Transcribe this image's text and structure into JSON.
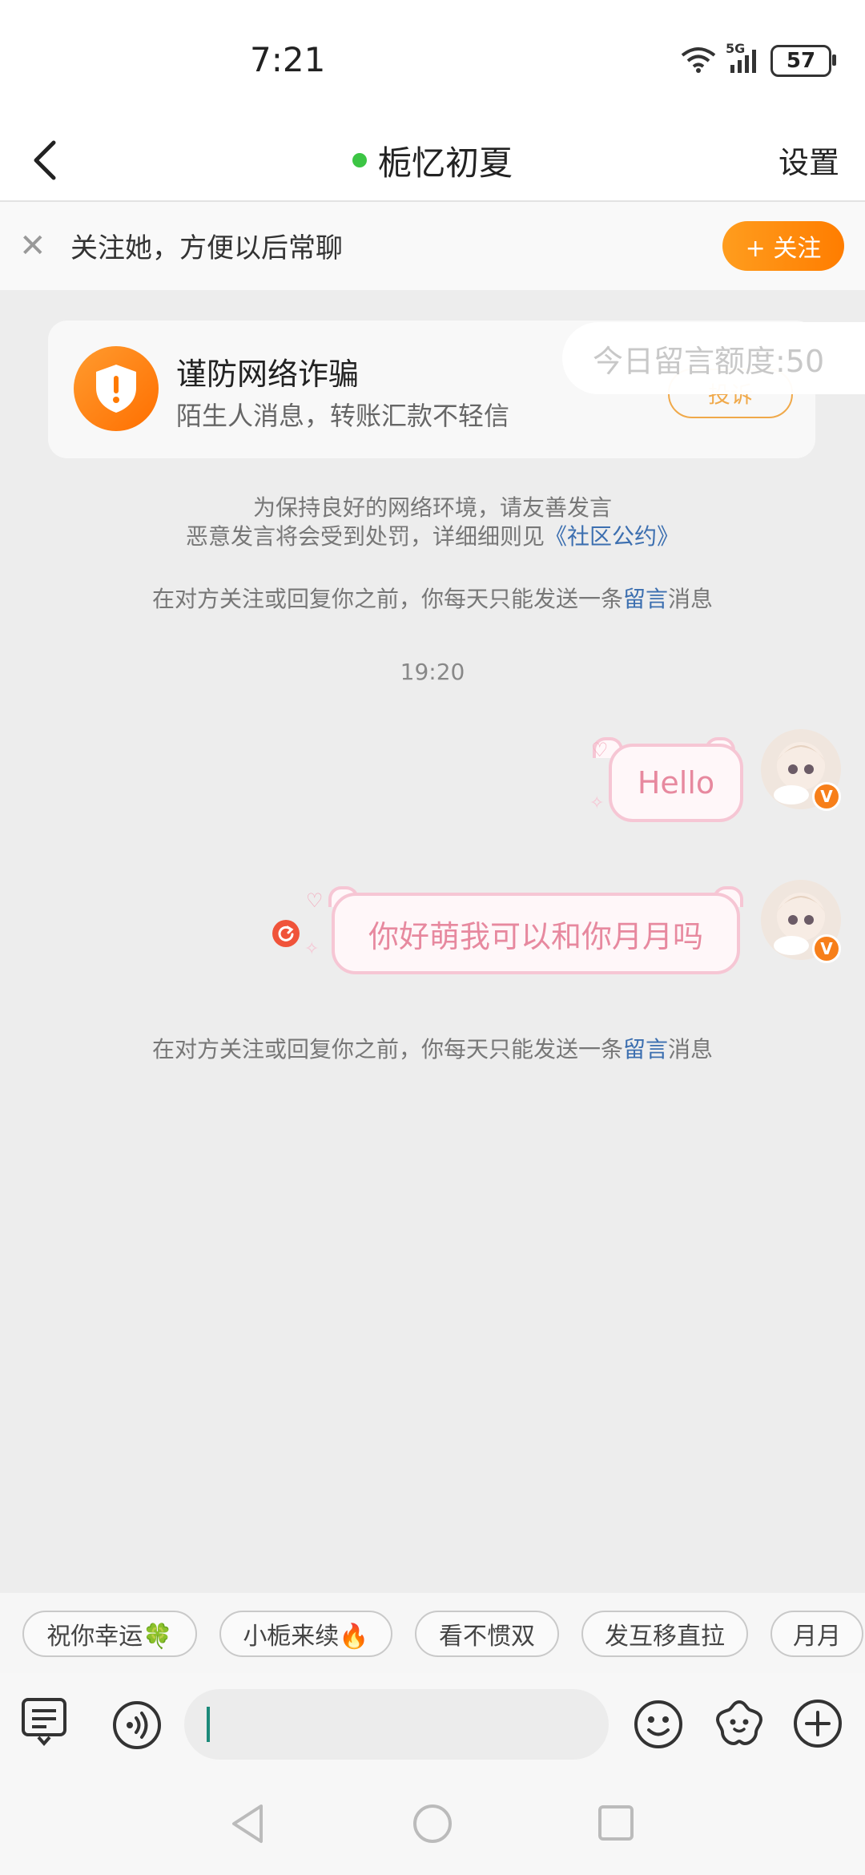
{
  "status_bar": {
    "time": "7:21",
    "network": "5G",
    "battery": "57"
  },
  "header": {
    "title": "栀忆初夏",
    "settings_label": "设置",
    "online": true
  },
  "follow_banner": {
    "text": "关注她，方便以后常聊",
    "button_label": "+ 关注"
  },
  "fraud_card": {
    "title": "谨防网络诈骗",
    "subtitle": "陌生人消息，转账汇款不轻信",
    "report_label": "投诉",
    "quota_label": "今日留言额度:50"
  },
  "notices": {
    "line1": "为保持良好的网络环境，请友善发言",
    "line2_prefix": "恶意发言将会受到处罚，详细细则见",
    "line2_link": "《社区公约》",
    "limit_prefix": "在对方关注或回复你之前，你每天只能发送一条",
    "limit_link": "留言",
    "limit_suffix": "消息"
  },
  "timestamp": "19:20",
  "messages": [
    {
      "text": "Hello"
    },
    {
      "text": "你好萌我可以和你月月吗"
    }
  ],
  "quick_replies": [
    "祝你幸运🍀",
    "小栀来续🔥",
    "看不惯双",
    "发互移直拉",
    "月月"
  ],
  "colors": {
    "accent": "#ff8a10",
    "bubble_border": "#f6c6d4",
    "bubble_text": "#e7899f",
    "link": "#3c6fb0",
    "online": "#3cc544"
  }
}
